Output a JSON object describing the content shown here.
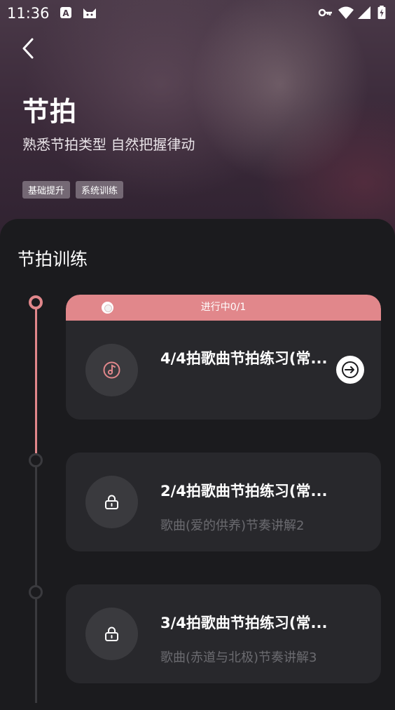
{
  "status_bar": {
    "time": "11:36",
    "left_icons": [
      "app-a-icon",
      "cat-icon"
    ],
    "right_icons": [
      "key-icon",
      "wifi-icon",
      "signal-icon",
      "battery-icon"
    ]
  },
  "header": {
    "title": "节拍",
    "subtitle": "熟悉节拍类型 自然把握律动",
    "tags": [
      "基础提升",
      "系统训练"
    ]
  },
  "section": {
    "title": "节拍训练"
  },
  "lessons": [
    {
      "status": "进行中0/1",
      "title": "4/4拍歌曲节拍练习(常...",
      "description": "",
      "icon": "music-note-icon",
      "locked": false
    },
    {
      "status": "",
      "title": "2/4拍歌曲节拍练习(常...",
      "description": "歌曲(爱的供养)节奏讲解2",
      "icon": "lock-icon",
      "locked": true
    },
    {
      "status": "",
      "title": "3/4拍歌曲节拍练习(常...",
      "description": "歌曲(赤道与北极)节奏讲解3",
      "icon": "lock-icon",
      "locked": true
    }
  ],
  "colors": {
    "accent": "#e1878b",
    "background": "#1b1b1e",
    "card": "#28282c",
    "muted_text": "#6b6b70"
  }
}
